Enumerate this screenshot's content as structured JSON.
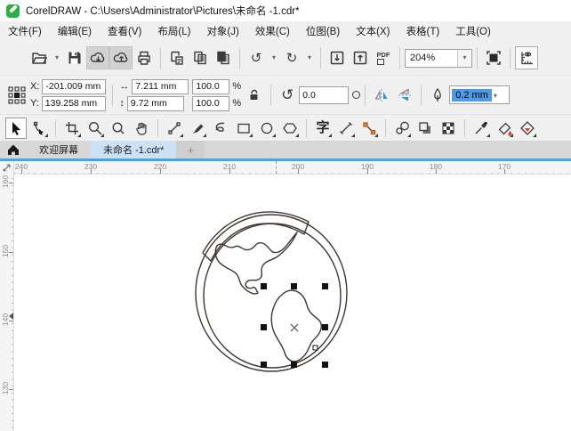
{
  "window": {
    "title": "CorelDRAW - C:\\Users\\Administrator\\Pictures\\未命名 -1.cdr*"
  },
  "menu": {
    "items": [
      {
        "label": "文件(F)"
      },
      {
        "label": "编辑(E)"
      },
      {
        "label": "查看(V)"
      },
      {
        "label": "布局(L)"
      },
      {
        "label": "对象(J)"
      },
      {
        "label": "效果(C)"
      },
      {
        "label": "位图(B)"
      },
      {
        "label": "文本(X)"
      },
      {
        "label": "表格(T)"
      },
      {
        "label": "工具(O)"
      }
    ]
  },
  "toolbar": {
    "zoom_level": "204%",
    "pdf_label": "PDF"
  },
  "property_bar": {
    "x_label": "X:",
    "y_label": "Y:",
    "x_value": "-201.009 mm",
    "y_value": "139.258 mm",
    "width_value": "7.211 mm",
    "height_value": "9.72 mm",
    "scale_h": "100.0",
    "scale_v": "100.0",
    "percent_h": "%",
    "percent_v": "%",
    "rotation_value": "0.0",
    "outline_width": "0.2 mm"
  },
  "toolbox": {
    "text_tool_glyph": "字"
  },
  "tabbar": {
    "welcome_tab": "欢迎屏幕",
    "document_tab": "未命名 -1.cdr*",
    "new_tab_label": "+"
  },
  "rulers": {
    "horizontal": [
      "240",
      "230",
      "220",
      "210",
      "200",
      "190",
      "180",
      "170"
    ],
    "vertical": [
      "160",
      "150",
      "140",
      "130"
    ]
  },
  "colors": {
    "accent_blue": "#41a8e8",
    "active_tab_bg": "#cbe2f6",
    "selection_highlight": "#4d9ae8",
    "app_icon_green": "#27b043",
    "drawing_stroke": "#3f3631"
  }
}
